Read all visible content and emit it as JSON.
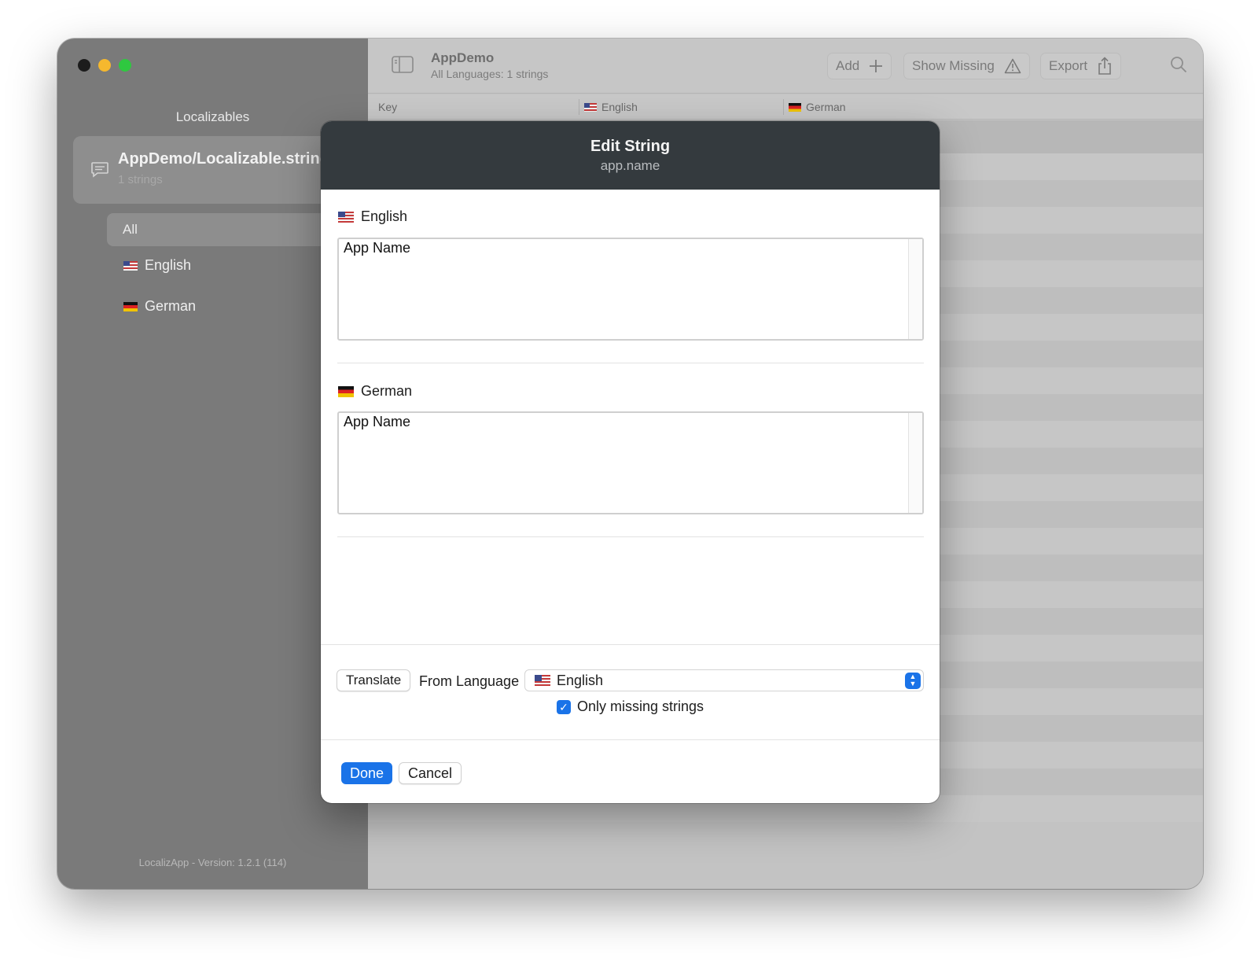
{
  "window": {
    "sidebar": {
      "heading": "Localizables",
      "file": {
        "title": "AppDemo/Localizable.strings",
        "subtitle": "1 strings",
        "icon": "message-bubble-icon"
      },
      "nav": {
        "all": "All",
        "languages": [
          {
            "label": "English",
            "flag": "us-flag-icon"
          },
          {
            "label": "German",
            "flag": "de-flag-icon"
          }
        ]
      },
      "footer": "LocalizApp - Version: 1.2.1 (114)"
    },
    "toolbar": {
      "title": "AppDemo",
      "subtitle": "All Languages: 1 strings",
      "add_label": "Add",
      "show_missing_label": "Show Missing",
      "export_label": "Export"
    },
    "table": {
      "columns": [
        "Key",
        "English",
        "German"
      ]
    }
  },
  "modal": {
    "title": "Edit String",
    "subtitle": "app.name",
    "fields": [
      {
        "language": "English",
        "value": "App Name"
      },
      {
        "language": "German",
        "value": "App Name"
      }
    ],
    "translate_label": "Translate",
    "from_language_label": "From Language",
    "from_language_value": "English",
    "only_missing_label": "Only missing strings",
    "only_missing_checked": true,
    "done_label": "Done",
    "cancel_label": "Cancel"
  },
  "colors": {
    "accent": "#1a73e8",
    "modal_header": "#343a3e",
    "sidebar": "#7a7a7a"
  }
}
